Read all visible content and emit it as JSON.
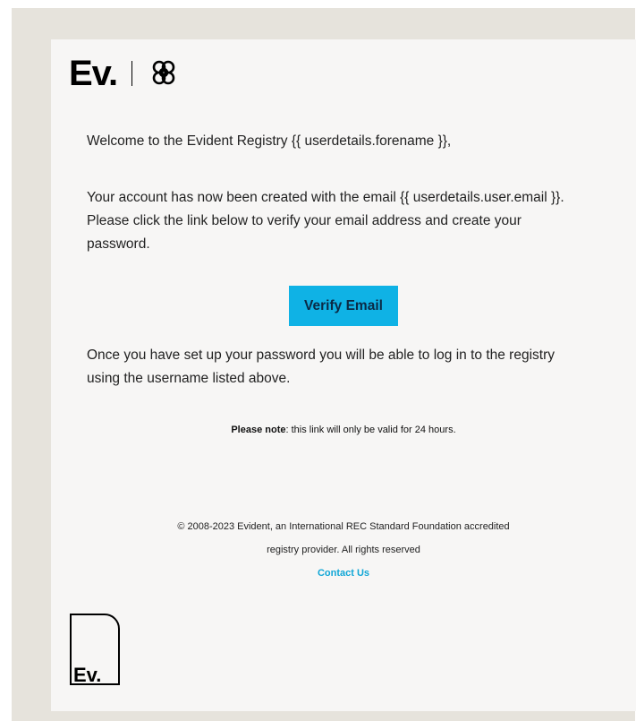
{
  "header": {
    "brand_text": "Ev.",
    "knot_icon": "knot-logo-icon"
  },
  "content": {
    "greeting": "Welcome to the Evident Registry {{ userdetails.forename }},",
    "account_created": "Your account has now been created with the email {{ userdetails.user.email }}. Please click the link below to verify your email address and create your password.",
    "verify_button_label": "Verify Email",
    "after_setup": "Once you have set up your password you will be able to log in to the registry using the username listed above.",
    "note_label": "Please note",
    "note_text": ": this link will only be valid for 24 hours."
  },
  "footer": {
    "copyright_line1": "© 2008-2023 Evident, an International REC Standard Foundation accredited",
    "copyright_line2": "registry provider. All rights reserved",
    "contact_label": "Contact Us"
  },
  "bottom_logo": {
    "text": "Ev."
  },
  "colors": {
    "accent": "#0fb2e5",
    "link": "#0fa6d6",
    "card_bg": "#f7f6f5",
    "outer_bg": "#e6e3dc"
  }
}
